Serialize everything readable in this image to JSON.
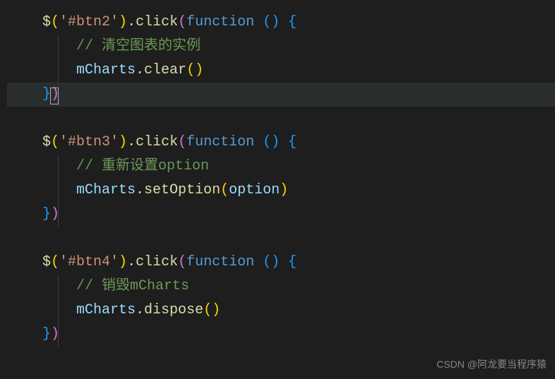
{
  "blocks": [
    {
      "selector": "'#btn2'",
      "comment": "// 清空图表的实例",
      "method": "clear",
      "args": "",
      "active": true
    },
    {
      "selector": "'#btn3'",
      "comment": "// 重新设置option",
      "method": "setOption",
      "args": "option",
      "active": false
    },
    {
      "selector": "'#btn4'",
      "comment": "// 销毁mCharts",
      "method": "dispose",
      "args": "",
      "active": false
    }
  ],
  "tokens": {
    "jquery": "$",
    "click": "click",
    "function_kw": "function",
    "object": "mCharts"
  },
  "watermark": "CSDN @阿龙要当程序猿"
}
